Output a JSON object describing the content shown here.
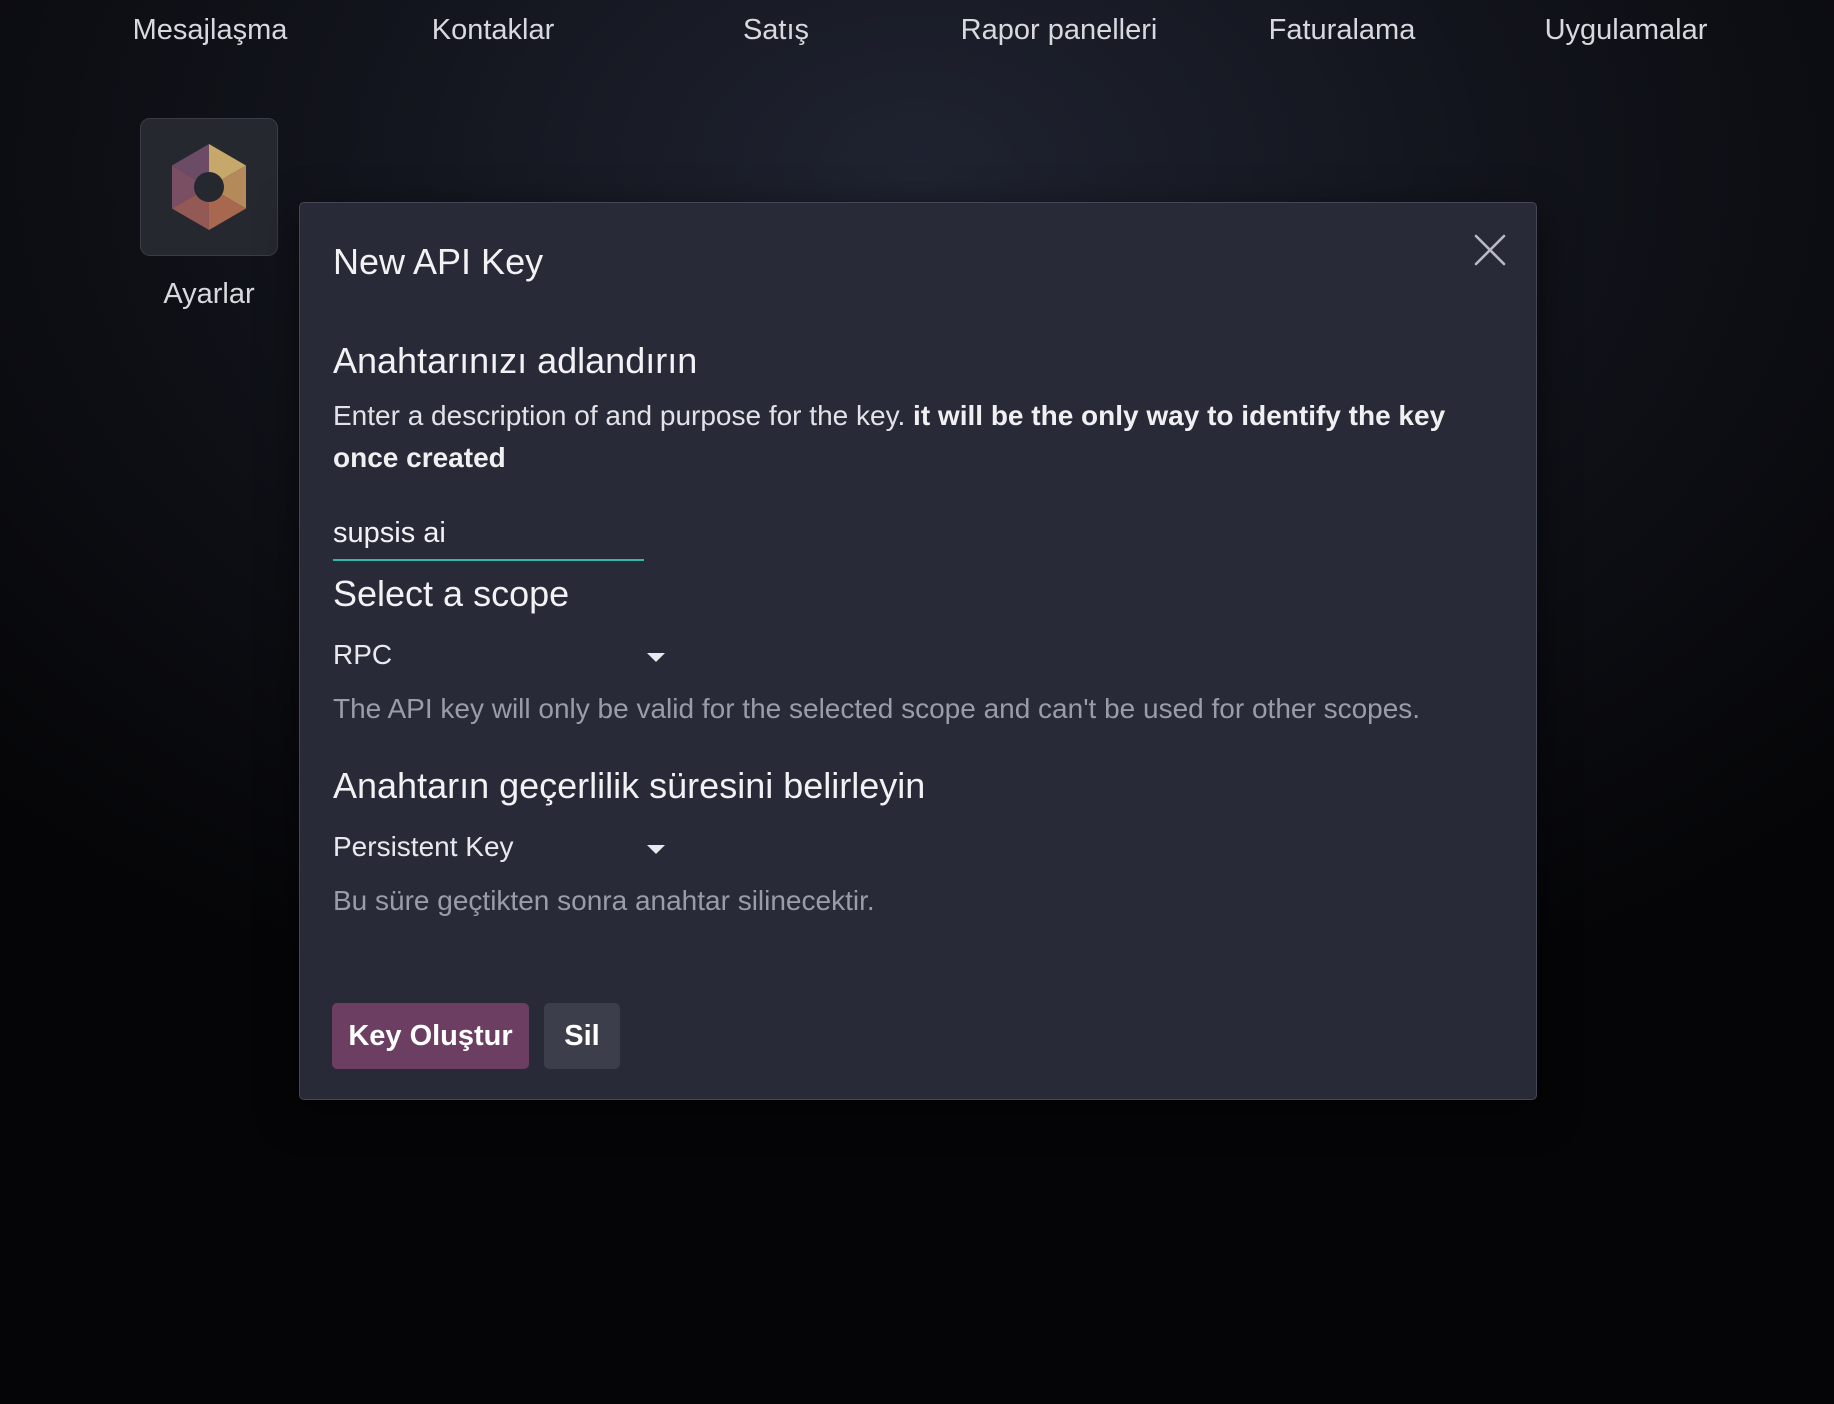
{
  "topbar": {
    "apps": [
      "Mesajlaşma",
      "Kontaklar",
      "Satış",
      "Rapor panelleri",
      "Faturalama",
      "Uygulamalar"
    ]
  },
  "tile": {
    "label": "Ayarlar",
    "icon": "settings-hexagon-icon"
  },
  "modal": {
    "title": "New API Key",
    "close_icon": "close-icon",
    "name_section": {
      "heading": "Anahtarınızı adlandırın",
      "description": "Enter a description of and purpose for the key.",
      "description_bold": "it will be the only way to identify the key once created",
      "input_value": "supsis ai"
    },
    "scope_section": {
      "heading": "Select a scope",
      "selected": "RPC",
      "help": "The API key will only be valid for the selected scope and can't be used for other scopes."
    },
    "duration_section": {
      "heading": "Anahtarın geçerlilik süresini belirleyin",
      "selected": "Persistent Key",
      "help": "Bu süre geçtikten sonra anahtar silinecektir."
    },
    "buttons": {
      "create": "Key Oluştur",
      "discard": "Sil"
    }
  },
  "colors": {
    "primary_button": "#6b3e62",
    "input_underline": "#2fb7a8",
    "modal_bg": "#282a37"
  }
}
